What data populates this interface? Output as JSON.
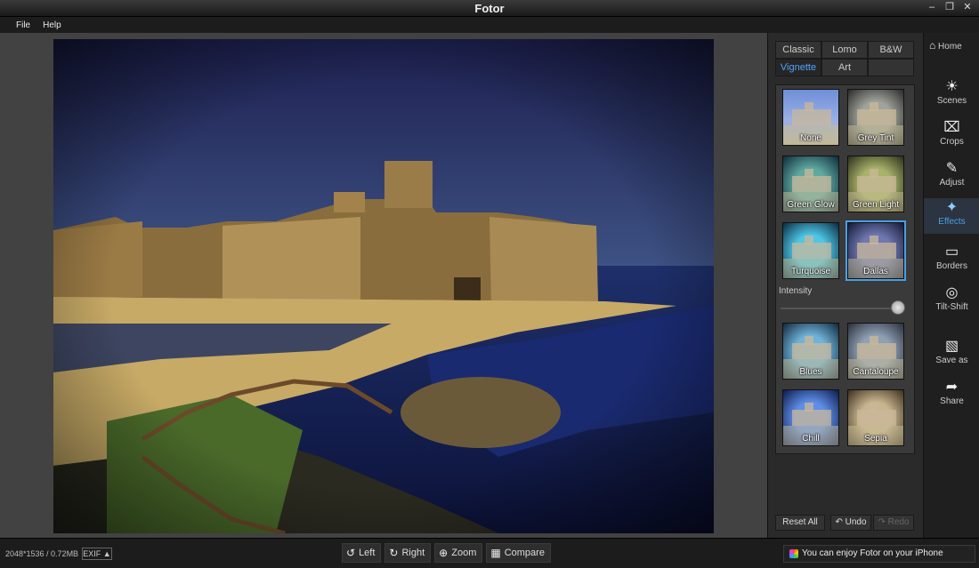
{
  "window": {
    "title": "Fotor"
  },
  "menu": [
    "File",
    "Help"
  ],
  "panel": {
    "tabs": [
      "Classic",
      "Lomo",
      "B&W",
      "Vignette",
      "Art"
    ],
    "active_tab": "Vignette",
    "effects": [
      "None",
      "Grey Tint",
      "Green Glow",
      "Green Light",
      "Turquoise",
      "Dallas",
      "Blues",
      "Cantaloupe",
      "Chill",
      "Sepia"
    ],
    "selected_effect": "Dallas",
    "intensity_label": "Intensity",
    "intensity_value": 1.0,
    "reset_all": "Reset All",
    "undo": "Undo",
    "redo": "Redo"
  },
  "sidebar": {
    "home": "Home",
    "items": [
      "Scenes",
      "Crops",
      "Adjust",
      "Effects",
      "Borders",
      "Tilt-Shift",
      "Save as",
      "Share"
    ],
    "active_item": "Effects"
  },
  "status": {
    "image_info": "2048*1536 / 0.72MB",
    "exif": "EXIF ▲",
    "tools": [
      "Left",
      "Right",
      "Zoom",
      "Compare"
    ],
    "promo": "You can enjoy Fotor on your iPhone"
  },
  "colors": {
    "accent": "#4aa0e6",
    "background": "#2b2b2b",
    "canvas": "#424242"
  }
}
